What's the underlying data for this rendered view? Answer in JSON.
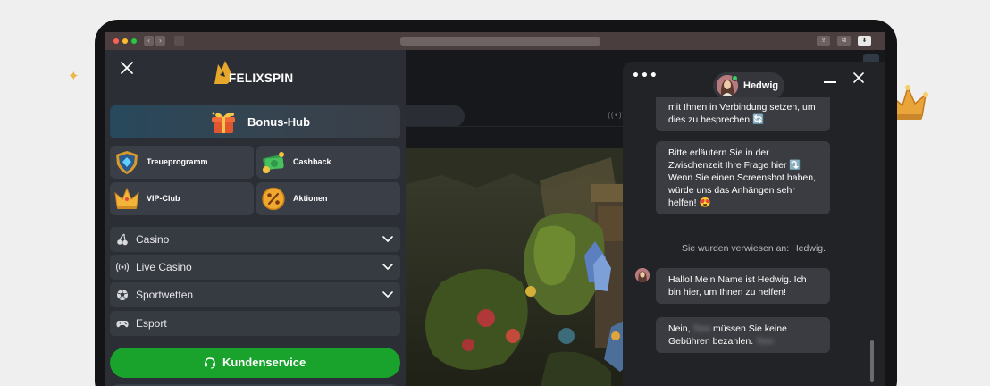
{
  "brand": {
    "name": "FELIXSPIN"
  },
  "sidebar": {
    "bonus_hub_label": "Bonus-Hub",
    "tiles": [
      {
        "label": "Treueprogramm",
        "icon": "shield-diamond-icon"
      },
      {
        "label": "Cashback",
        "icon": "cash-icon"
      },
      {
        "label": "VIP-Club",
        "icon": "crown-icon"
      },
      {
        "label": "Aktionen",
        "icon": "percent-icon"
      }
    ],
    "menu": [
      {
        "label": "Casino",
        "icon": "cherries-icon",
        "expandable": true
      },
      {
        "label": "Live Casino",
        "icon": "broadcast-icon",
        "expandable": true
      },
      {
        "label": "Sportwetten",
        "icon": "soccer-ball-icon",
        "expandable": true
      },
      {
        "label": "Esport",
        "icon": "gamepad-icon",
        "expandable": false
      }
    ],
    "support_button_label": "Kundenservice"
  },
  "chat": {
    "agent_name": "Hedwig",
    "messages": {
      "m1_text": "mit Ihnen in Verbindung setzen, um dies zu besprechen",
      "m1_emoji": "🔄",
      "m2_text": "Bitte erläutern Sie in der Zwischenzeit Ihre Frage hier",
      "m2_emoji1": "⤵️",
      "m2_text2": "Wenn Sie einen Screenshot haben, würde uns das Anhängen sehr helfen!",
      "m2_emoji2": "😍",
      "system": "Sie wurden verwiesen an: Hedwig.",
      "m3_text": "Hallo! Mein Name ist Hedwig. Ich bin hier, um Ihnen zu helfen!",
      "m4_before": "Nein,",
      "m4_blur1": "Tom",
      "m4_middle": "müssen Sie keine Gebühren bezahlen.",
      "m4_blur2": "Tom"
    }
  },
  "colors": {
    "sidebar_bg": "#2b2e34",
    "accent_green": "#19a32d",
    "chat_bg": "#222327",
    "bubble_bg": "#3b3c41"
  }
}
